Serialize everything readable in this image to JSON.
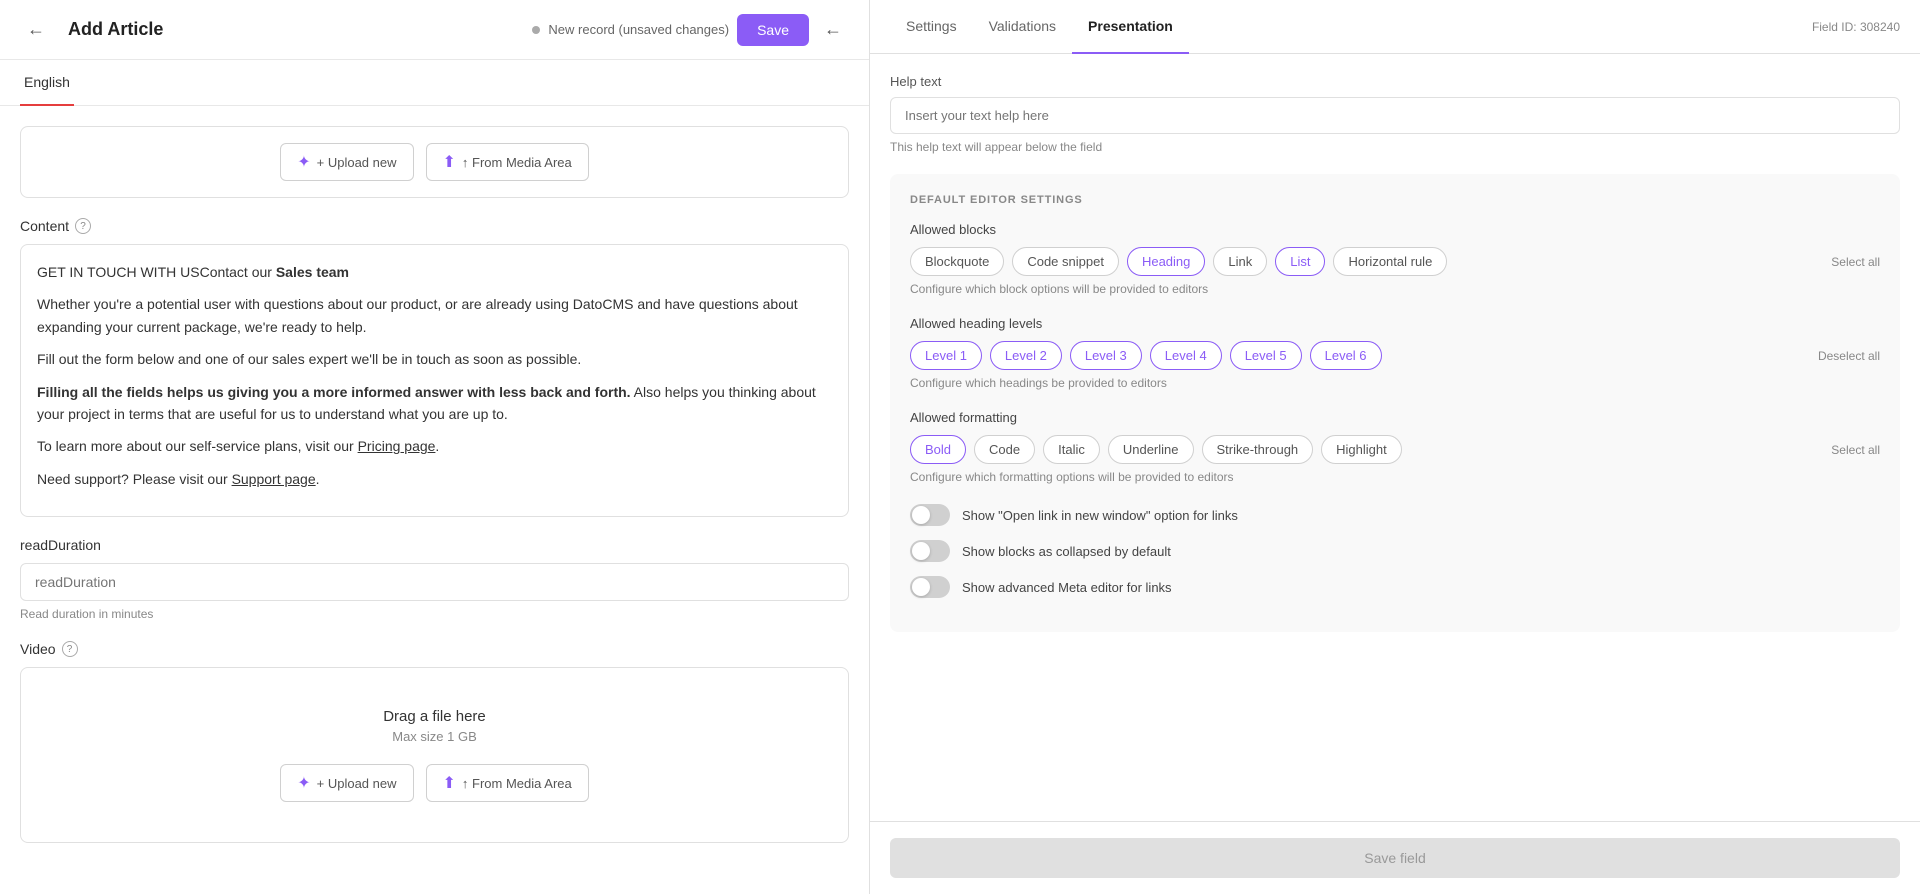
{
  "header": {
    "back_label": "←",
    "title": "Add Article",
    "status_text": "New record (unsaved changes)",
    "save_label": "Save",
    "arrow_label": "←"
  },
  "tabs": {
    "language_tab": "English"
  },
  "upload": {
    "upload_new_label": "+ Upload new",
    "from_media_label": "↑ From Media Area"
  },
  "content_section": {
    "label": "Content",
    "help_icon": "?",
    "intro_text": "GET IN TOUCH WITH US",
    "intro_bold": "Sales team",
    "para1": "Whether you're a potential user with questions about our product, or are already using DatoCMS and have questions about expanding your current package, we're ready to help.",
    "para2": "Fill out the form below and one of our sales expert we'll be in touch as soon as possible.",
    "para3_bold": "Filling all the fields helps us giving you a more informed answer with less back and forth.",
    "para3_rest": " Also helps you thinking about your project in terms that are useful for us to understand what you are up to.",
    "para4_prefix": "To learn more about our self-service plans, visit our ",
    "para4_link": "Pricing page",
    "para4_suffix": ".",
    "para5_prefix": "Need support? Please visit our ",
    "para5_link": "Support page",
    "para5_suffix": "."
  },
  "read_duration": {
    "label": "readDuration",
    "placeholder": "readDuration",
    "hint": "Read duration in minutes"
  },
  "video_section": {
    "label": "Video",
    "help_icon": "?",
    "drag_title": "Drag a file here",
    "drag_subtitle": "Max size 1 GB",
    "upload_new_label": "+ Upload new",
    "from_media_label": "↑ From Media Area"
  },
  "right_panel": {
    "tabs": [
      {
        "label": "Settings",
        "active": false
      },
      {
        "label": "Validations",
        "active": false
      },
      {
        "label": "Presentation",
        "active": true
      }
    ],
    "field_id": "Field ID: 308240",
    "help_text": {
      "label": "Help text",
      "placeholder": "Insert your text help here",
      "hint": "This help text will appear below the field"
    },
    "settings_title": "DEFAULT EDITOR SETTINGS",
    "allowed_blocks": {
      "label": "Allowed blocks",
      "hint": "Configure which block options will be provided to editors",
      "select_all_label": "Select all",
      "items": [
        {
          "label": "Blockquote",
          "active": false
        },
        {
          "label": "Code snippet",
          "active": false
        },
        {
          "label": "Heading",
          "active": true
        },
        {
          "label": "Link",
          "active": false
        },
        {
          "label": "List",
          "active": true
        },
        {
          "label": "Horizontal rule",
          "active": false
        }
      ]
    },
    "allowed_headings": {
      "label": "Allowed heading levels",
      "hint": "Configure which headings be provided to editors",
      "deselect_all_label": "Deselect all",
      "items": [
        {
          "label": "Level 1",
          "active": true
        },
        {
          "label": "Level 2",
          "active": true
        },
        {
          "label": "Level 3",
          "active": true
        },
        {
          "label": "Level 4",
          "active": true
        },
        {
          "label": "Level 5",
          "active": true
        },
        {
          "label": "Level 6",
          "active": true
        }
      ]
    },
    "allowed_formatting": {
      "label": "Allowed formatting",
      "hint": "Configure which formatting options will be provided to editors",
      "select_all_label": "Select all",
      "items": [
        {
          "label": "Bold",
          "active": true
        },
        {
          "label": "Code",
          "active": false
        },
        {
          "label": "Italic",
          "active": false
        },
        {
          "label": "Underline",
          "active": false
        },
        {
          "label": "Strike-through",
          "active": false
        },
        {
          "label": "Highlight",
          "active": false
        }
      ]
    },
    "toggles": [
      {
        "label": "Show \"Open link in new window\" option for links",
        "enabled": false
      },
      {
        "label": "Show blocks as collapsed by default",
        "enabled": false
      },
      {
        "label": "Show advanced Meta editor for links",
        "enabled": false
      }
    ],
    "save_field_label": "Save field"
  }
}
